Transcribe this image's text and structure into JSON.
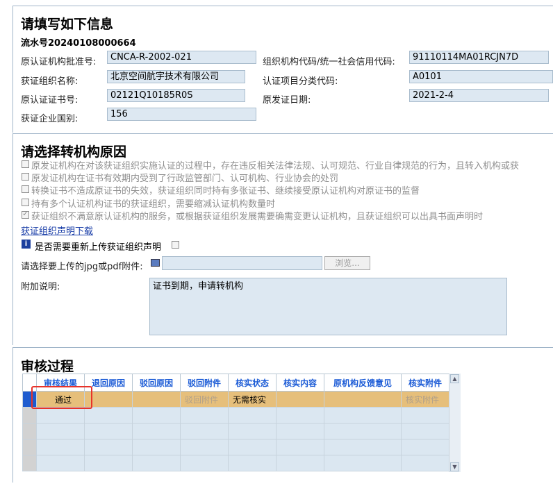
{
  "info": {
    "title": "请填写如下信息",
    "serial": "流水号20240108000664",
    "fields": {
      "orig_approval_no_label": "原认证机构批准号:",
      "orig_approval_no": "CNCA-R-2002-021",
      "org_code_label": "组织机构代码/统一社会信用代码:",
      "org_code": "91110114MA01RCJN7D",
      "org_name_label": "获证组织名称:",
      "org_name": "北京空间航宇技术有限公司",
      "cert_category_label": "认证项目分类代码:",
      "cert_category": "A0101",
      "orig_cert_no_label": "原认证证书号:",
      "orig_cert_no": "02121Q10185R0S",
      "orig_issue_date_label": "原发证日期:",
      "orig_issue_date": "2021-2-4",
      "country_label": "获证企业国别:",
      "country": "156"
    }
  },
  "reasons": {
    "title": "请选择转机构原因",
    "items": [
      {
        "text": "原发证机构在对该获证组织实施认证的过程中，存在违反相关法律法规、认可规范、行业自律规范的行为，且转入机构或获",
        "checked": false
      },
      {
        "text": "原发证机构在证书有效期内受到了行政监管部门、认可机构、行业协会的处罚",
        "checked": false
      },
      {
        "text": "转换证书不造成原证书的失效，获证组织同时持有多张证书、继续接受原认证机构对原证书的监督",
        "checked": false
      },
      {
        "text": "持有多个认证机构证书的获证组织，需要缩减认证机构数量时",
        "checked": false
      },
      {
        "text": "获证组织不满意原认证机构的服务，或根据获证组织发展需要确需变更认证机构，且获证组织可以出具书面声明时",
        "checked": true
      }
    ],
    "download_link": "获证组织声明下载",
    "reupload_label": "是否需要重新上传获证组织声明",
    "upload_label": "请选择要上传的jpg或pdf附件:",
    "upload_value": "",
    "browse_label": "浏览...",
    "remark_label": "附加说明:",
    "remark_value": "证书到期，申请转机构"
  },
  "review": {
    "title": "审核过程",
    "columns": [
      "审核结果",
      "退回原因",
      "驳回原因",
      "驳回附件",
      "核实状态",
      "核实内容",
      "原机构反馈意见",
      "核实附件"
    ],
    "rows": [
      [
        "通过",
        "",
        "",
        "驳回附件",
        "无需核实",
        "",
        "",
        "核实附件"
      ]
    ],
    "empty_rows": 4,
    "highlight_color": "#e6bf7b",
    "annotation_color": "#e8332a"
  }
}
